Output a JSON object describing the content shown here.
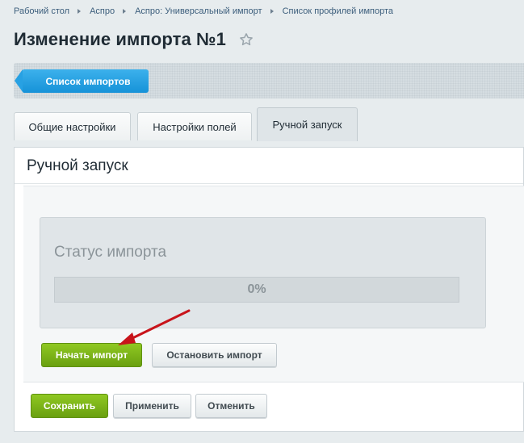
{
  "breadcrumb": [
    "Рабочий стол",
    "Аспро",
    "Аспро: Универсальный импорт",
    "Список профилей импорта"
  ],
  "header": {
    "title": "Изменение импорта №1"
  },
  "toolbar": {
    "list_label": "Список импортов"
  },
  "tabs": [
    {
      "label": "Общие настройки",
      "active": false
    },
    {
      "label": "Настройки полей",
      "active": false
    },
    {
      "label": "Ручной запуск",
      "active": true
    }
  ],
  "panel": {
    "heading": "Ручной запуск",
    "status_title": "Статус импорта",
    "progress_text": "0%",
    "progress_value": 0,
    "start_label": "Начать импорт",
    "stop_label": "Остановить импорт"
  },
  "footer": {
    "save_label": "Сохранить",
    "apply_label": "Применить",
    "cancel_label": "Отменить"
  },
  "colors": {
    "accent_blue": "#1692d8",
    "accent_green": "#7bb51d",
    "arrow_red": "#c8141b"
  }
}
